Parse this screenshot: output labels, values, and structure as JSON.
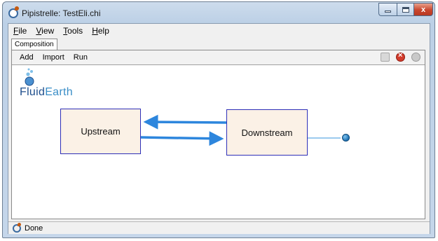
{
  "window": {
    "title": "Pipistrelle: TestEli.chi",
    "controls": {
      "close_glyph": "x"
    }
  },
  "menu": {
    "items": [
      {
        "id": "file",
        "label": "File"
      },
      {
        "id": "view",
        "label": "View"
      },
      {
        "id": "tools",
        "label": "Tools"
      },
      {
        "id": "help",
        "label": "Help"
      }
    ]
  },
  "tabs": [
    {
      "label": "Composition",
      "selected": true
    }
  ],
  "toolbar": {
    "buttons": [
      {
        "id": "add",
        "label": "Add"
      },
      {
        "id": "import",
        "label": "Import"
      },
      {
        "id": "run",
        "label": "Run"
      }
    ],
    "icons": [
      "validate-icon",
      "remove-icon",
      "info-icon"
    ]
  },
  "logo": {
    "part1": "Fluid",
    "part2": "Earth",
    "icon": "bubbles-icon"
  },
  "components": [
    {
      "id": "upstream",
      "label": "Upstream"
    },
    {
      "id": "downstream",
      "label": "Downstream"
    }
  ],
  "links": [
    {
      "from": "Downstream",
      "to": "Upstream",
      "color": "#2d86dd"
    },
    {
      "from": "Upstream",
      "to": "Downstream",
      "color": "#2d86dd"
    },
    {
      "from": "Downstream",
      "to": "trigger",
      "color": "#7ab8e8"
    }
  ],
  "trigger": {
    "icon": "globe-icon"
  },
  "status": {
    "text": "Done",
    "icon": "app-status-icon"
  },
  "colors": {
    "component_fill": "#fbf1e6",
    "component_border": "#2e2fb8",
    "link": "#2d86dd",
    "logo_fluid": "#1e4e8c",
    "logo_earth": "#3a8ec7"
  }
}
